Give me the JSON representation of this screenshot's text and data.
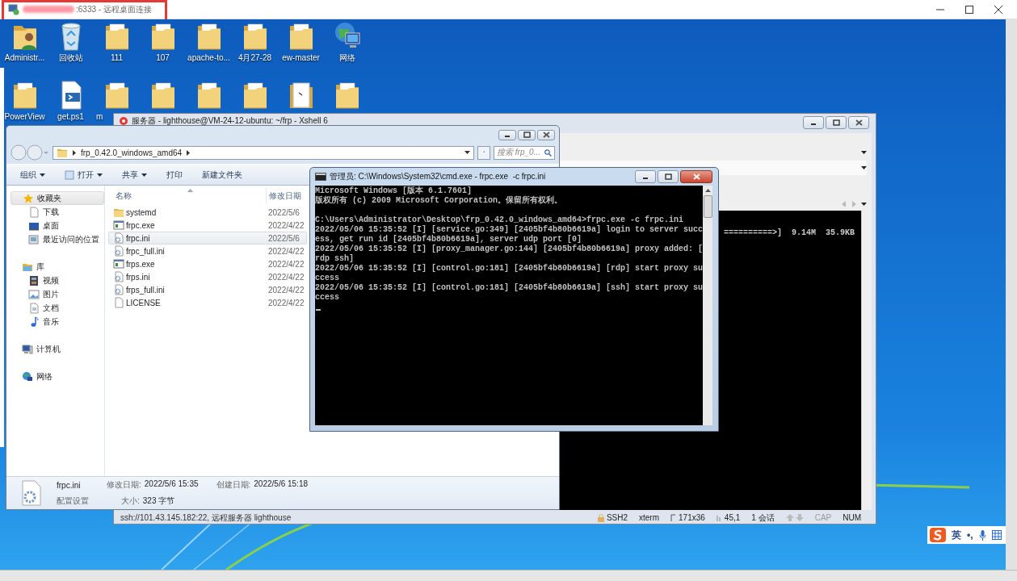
{
  "remote_window": {
    "title": ":6333 - 远程桌面连接",
    "highlighted": true
  },
  "desktop_icons": [
    {
      "kind": "user",
      "label": "Administr..."
    },
    {
      "kind": "recycle",
      "label": "回收站"
    },
    {
      "kind": "folder",
      "label": "111"
    },
    {
      "kind": "folder",
      "label": "107"
    },
    {
      "kind": "folder",
      "label": "apache-to..."
    },
    {
      "kind": "folder",
      "label": "4月27-28"
    },
    {
      "kind": "folder",
      "label": "ew-master"
    },
    {
      "kind": "network",
      "label": "网络"
    },
    {
      "kind": "folder",
      "label": "PowerView"
    },
    {
      "kind": "script",
      "label": "get.ps1"
    },
    {
      "kind": "folder",
      "label": "m",
      "cut": true
    },
    {
      "kind": "folder"
    },
    {
      "kind": "folder"
    },
    {
      "kind": "folder"
    },
    {
      "kind": "document"
    },
    {
      "kind": "folder"
    }
  ],
  "xshell": {
    "title": "服务器 - lighthouse@VM-24-12-ubuntu: ~/frp - Xshell 6",
    "terminal_line": "==========>]  9.14M  35.9KB",
    "status_text": "ssh://101.43.145.182:22, 远程服务器 lighthouse",
    "status_items": [
      {
        "kind": "lock",
        "text": "SSH2"
      },
      {
        "kind": "plain",
        "text": "xterm"
      },
      {
        "kind": "size",
        "text": "171x36"
      },
      {
        "kind": "cursor",
        "text": "45,1"
      },
      {
        "kind": "plain",
        "text": "1 会话"
      },
      {
        "kind": "arrows"
      },
      {
        "kind": "key",
        "text": "CAP",
        "on": false
      },
      {
        "kind": "key",
        "text": "NUM",
        "on": true
      }
    ]
  },
  "explorer": {
    "path": "frp_0.42.0_windows_amd64",
    "search_placeholder": "搜索 frp_0...",
    "toolbar": [
      {
        "kind": "menu",
        "label": "组织"
      },
      {
        "kind": "open",
        "label": "打开"
      },
      {
        "kind": "menu",
        "label": "共享"
      },
      {
        "kind": "plain",
        "label": "打印"
      },
      {
        "kind": "plain",
        "label": "新建文件夹"
      }
    ],
    "nav": [
      {
        "kind": "favorites",
        "label": "收藏夹",
        "selected": true,
        "children": [
          {
            "kind": "download",
            "label": "下载",
            "selected": false
          },
          {
            "kind": "desktop",
            "label": "桌面",
            "selected": false
          },
          {
            "kind": "recent",
            "label": "最近访问的位置",
            "selected": false
          }
        ]
      },
      {
        "kind": "library",
        "label": "库",
        "selected": false,
        "children": [
          {
            "kind": "video",
            "label": "视频",
            "selected": false
          },
          {
            "kind": "picture",
            "label": "图片",
            "selected": false
          },
          {
            "kind": "document",
            "label": "文档",
            "selected": false
          },
          {
            "kind": "music",
            "label": "音乐",
            "selected": false
          }
        ]
      },
      {
        "kind": "computer",
        "label": "计算机",
        "selected": false
      },
      {
        "kind": "network",
        "label": "网络",
        "selected": false
      }
    ],
    "columns": [
      "名称",
      "修改日期"
    ],
    "files": [
      {
        "kind": "folder",
        "name": "systemd",
        "modified": "2022/5/6",
        "selected": false
      },
      {
        "kind": "exe",
        "name": "frpc.exe",
        "modified": "2022/4/22",
        "selected": false
      },
      {
        "kind": "ini",
        "name": "frpc.ini",
        "modified": "2022/5/6",
        "selected": true
      },
      {
        "kind": "ini",
        "name": "frpc_full.ini",
        "modified": "2022/4/22",
        "selected": false
      },
      {
        "kind": "exe",
        "name": "frps.exe",
        "modified": "2022/4/22",
        "selected": false
      },
      {
        "kind": "ini",
        "name": "frps.ini",
        "modified": "2022/4/22",
        "selected": false
      },
      {
        "kind": "ini",
        "name": "frps_full.ini",
        "modified": "2022/4/22",
        "selected": false
      },
      {
        "kind": "blank",
        "name": "LICENSE",
        "modified": "2022/4/22",
        "selected": false
      }
    ],
    "details": {
      "name": "frpc.ini",
      "type": "配置设置",
      "modified_label": "修改日期:",
      "modified": "2022/5/6 15:35",
      "created_label": "创建日期:",
      "created": "2022/5/6 15:18",
      "size_label": "大小:",
      "size": "323 字节"
    }
  },
  "cmd": {
    "title": "管理员: C:\\Windows\\System32\\cmd.exe - frpc.exe  -c frpc.ini",
    "blocks": [
      [
        "Microsoft Windows [版本 6.1.7601]",
        "版权所有 (c) 2009 Microsoft Corporation。保留所有权利。"
      ],
      [
        "C:\\Users\\Administrator\\Desktop\\frp_0.42.0_windows_amd64>frpc.exe -c frpc.ini",
        "2022/05/06 15:35:52 [I] [service.go:349] [2405bf4b80b6619a] login to server succ",
        "ess, get run id [2405bf4b80b6619a], server udp port [0]",
        "2022/05/06 15:35:52 [I] [proxy_manager.go:144] [2405bf4b80b6619a] proxy added: [",
        "rdp ssh]",
        "2022/05/06 15:35:52 [I] [control.go:181] [2405bf4b80b6619a] [rdp] start proxy su",
        "ccess",
        "2022/05/06 15:35:52 [I] [control.go:181] [2405bf4b80b6619a] [ssh] start proxy su",
        "ccess"
      ]
    ]
  },
  "ime": {
    "mode": "英",
    "punct": "•,"
  }
}
